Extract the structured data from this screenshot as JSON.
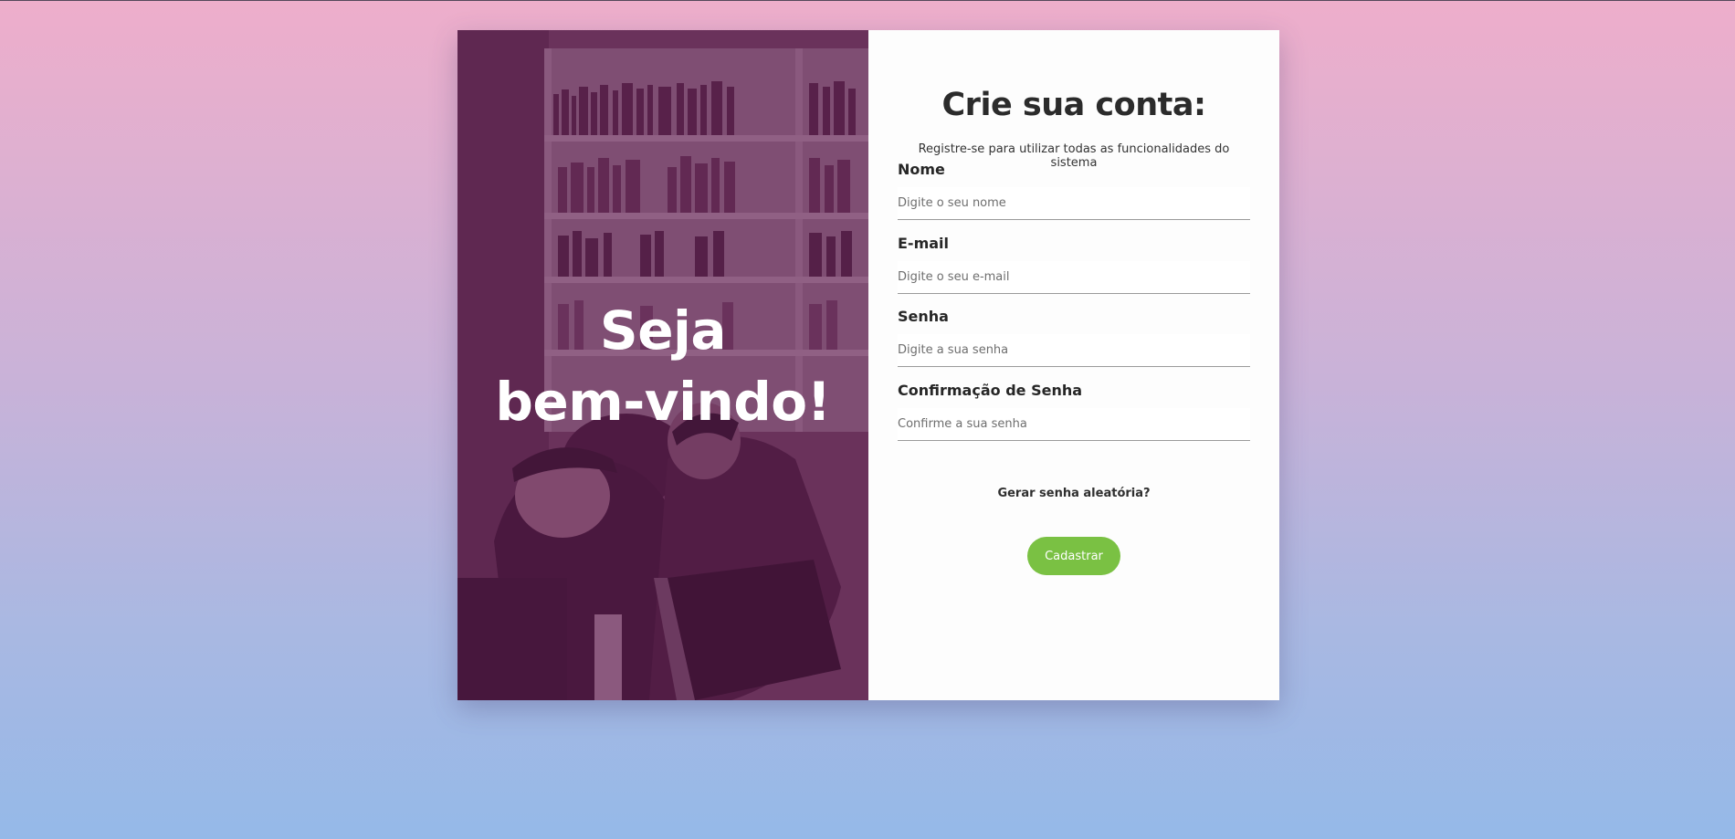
{
  "hero": {
    "line1": "Seja",
    "line2": "bem-vindo!"
  },
  "form": {
    "title": "Crie sua conta:",
    "subtitle": "Registre-se para utilizar todas as funcionalidades do sistema",
    "fields": [
      {
        "label": "Nome",
        "placeholder": "Digite o seu nome",
        "value": ""
      },
      {
        "label": "E-mail",
        "placeholder": "Digite o seu e-mail",
        "value": ""
      },
      {
        "label": "Senha",
        "placeholder": "Digite a sua senha",
        "value": ""
      },
      {
        "label": "Confirmação de Senha",
        "placeholder": "Confirme a sua senha",
        "value": ""
      }
    ],
    "random_password_link": "Gerar senha aleatória?",
    "submit_label": "Cadastrar"
  },
  "colors": {
    "accent_green": "#7ac143",
    "hero_overlay": "#5d2b4e",
    "background_top": "#eeaecb",
    "background_bottom": "#95b9e8"
  }
}
